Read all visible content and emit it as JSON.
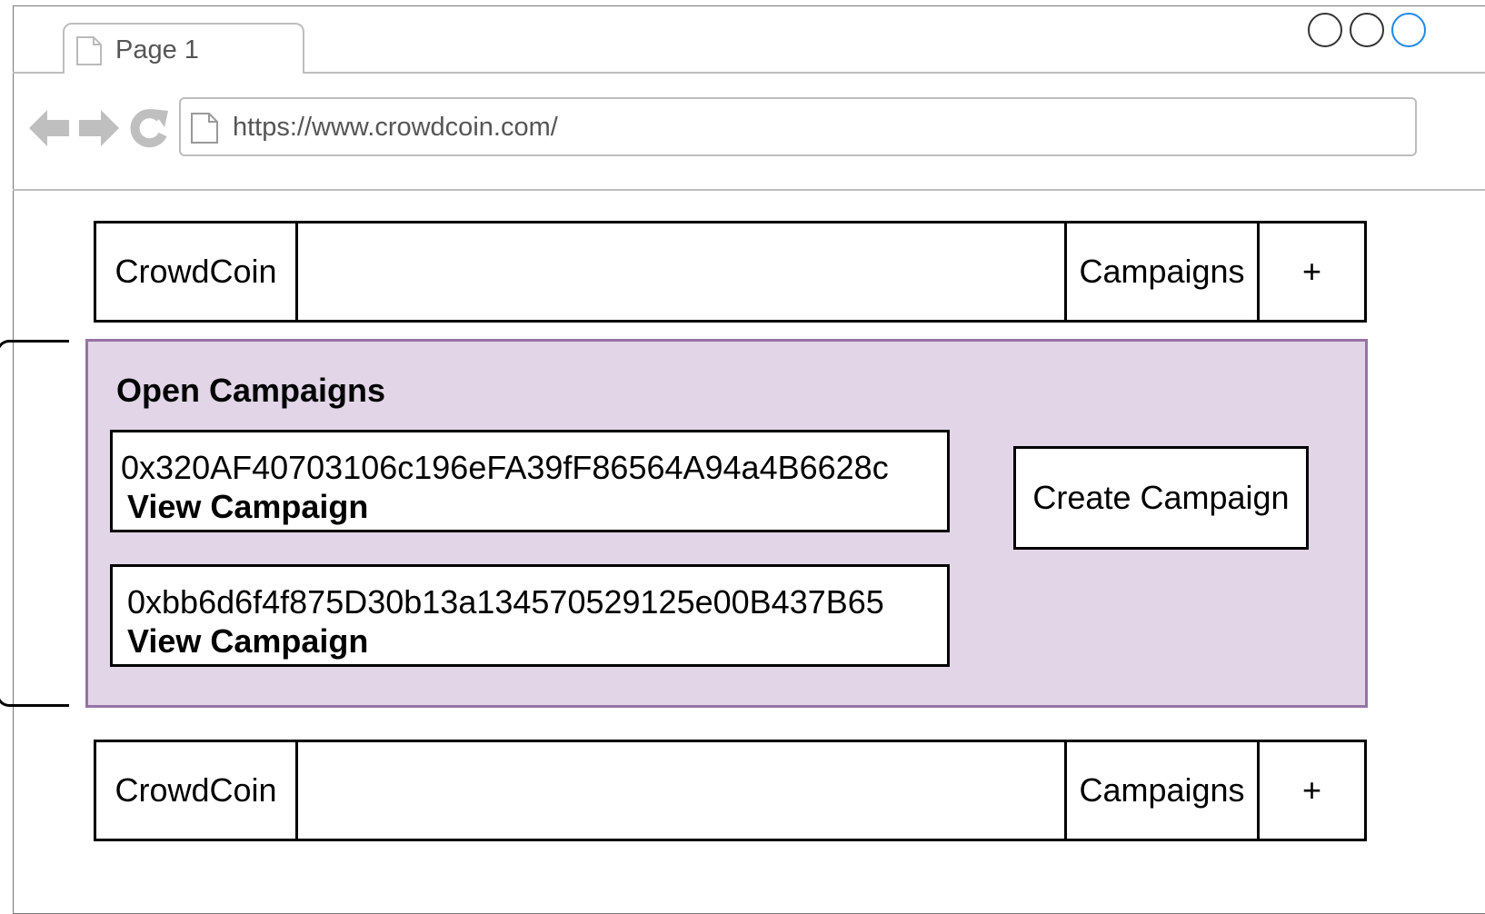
{
  "browser": {
    "tab_title": "Page 1",
    "url": "https://www.crowdcoin.com/",
    "icons": [
      "back-arrow-icon",
      "forward-arrow-icon",
      "reload-icon",
      "page-icon"
    ]
  },
  "header": {
    "brand": "CrowdCoin",
    "campaigns_link": "Campaigns",
    "add_button": "+"
  },
  "main": {
    "title": "Open Campaigns",
    "campaigns": [
      {
        "address": "0x320AF40703106c196eFA39fF86564A94a4B6628c",
        "link_label": "View Campaign"
      },
      {
        "address": "0xbb6d6f4f875D30b13a134570529125e00B437B65",
        "link_label": "View Campaign"
      }
    ],
    "create_button": "Create Campaign",
    "panel_fill": "#e1d5e7",
    "panel_border": "#9673a6"
  },
  "footer": {
    "brand": "CrowdCoin",
    "campaigns_link": "Campaigns",
    "add_button": "+"
  }
}
